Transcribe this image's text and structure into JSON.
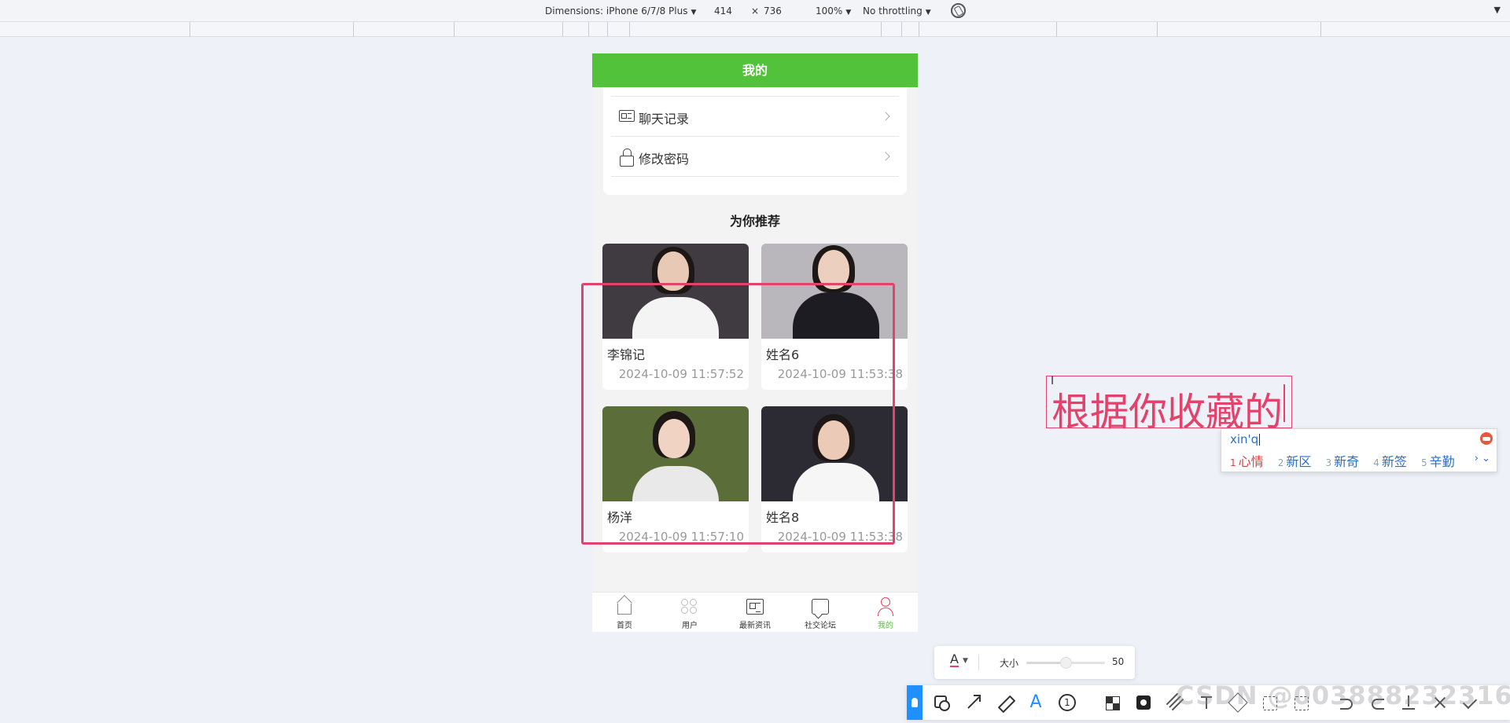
{
  "devtools": {
    "dimensions_label": "Dimensions: iPhone 6/7/8 Plus",
    "width": "414",
    "times": "×",
    "height": "736",
    "zoom": "100%",
    "throttling": "No throttling"
  },
  "phone": {
    "header_title": "我的",
    "menu_items": [
      {
        "label": "聊天记录",
        "icon": "id-card-icon"
      },
      {
        "label": "修改密码",
        "icon": "lock-icon"
      }
    ],
    "section_title": "为你推荐",
    "cards": [
      {
        "name": "李锦记",
        "time": "2024-10-09 11:57:52",
        "bg": "#3f3b40",
        "shirt": "#f4f4f4",
        "skin": "#e8c9b6"
      },
      {
        "name": "姓名6",
        "time": "2024-10-09 11:53:38",
        "bg": "#b9b6bc",
        "shirt": "#1c1c22",
        "skin": "#eccfbf"
      },
      {
        "name": "杨洋",
        "time": "2024-10-09 11:57:10",
        "bg": "#5b6e3a",
        "shirt": "#e9e9e9",
        "skin": "#f0d3c2"
      },
      {
        "name": "姓名8",
        "time": "2024-10-09 11:53:38",
        "bg": "#2c2a33",
        "shirt": "#f6f6f6",
        "skin": "#ebcbb8"
      }
    ],
    "tabs": [
      {
        "label": "首页",
        "icon": "home-icon"
      },
      {
        "label": "用户",
        "icon": "users-icon"
      },
      {
        "label": "最新资讯",
        "icon": "news-icon"
      },
      {
        "label": "社交论坛",
        "icon": "forum-icon"
      },
      {
        "label": "我的",
        "icon": "user-icon",
        "active": true
      }
    ]
  },
  "annotation": {
    "text": "根据你收藏的",
    "color": "#e3436a"
  },
  "ime": {
    "input": "xin'q",
    "candidates": [
      {
        "num": "1",
        "text": "心情"
      },
      {
        "num": "2",
        "text": "新区"
      },
      {
        "num": "3",
        "text": "新奇"
      },
      {
        "num": "4",
        "text": "新签"
      },
      {
        "num": "5",
        "text": "辛勤"
      }
    ],
    "more": "› ⌄"
  },
  "screenshot_tool": {
    "font_icon": "A",
    "size_label": "大小",
    "size_value": "50",
    "size_fraction": 0.5,
    "tools": [
      "shape-tool-icon",
      "arrow-tool-icon",
      "pen-tool-icon",
      "text-tool-icon",
      "number-tool-icon",
      "mosaic-tool-icon",
      "blur-tool-icon",
      "eraser-tool-icon",
      "pin-text-icon",
      "crop-icon",
      "translate-icon",
      "ocr-icon",
      "undo-icon",
      "redo-icon",
      "download-icon",
      "close-icon",
      "confirm-icon"
    ],
    "number_glyph": "1",
    "text_glyph": "A"
  },
  "watermark": "CSDN @003888232316"
}
